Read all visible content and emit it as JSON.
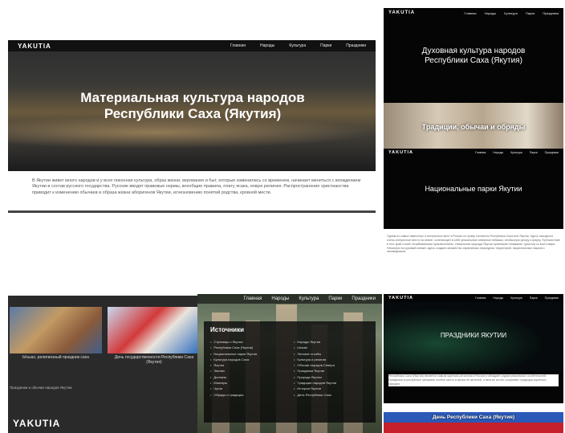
{
  "brand": "YAKUTIA",
  "nav": [
    "Главная",
    "Народы",
    "Культура",
    "Парки",
    "Праздники"
  ],
  "hero": {
    "title": "Материальная культура народов Республики Саха (Якутия)",
    "text": "В Якутии живет много народов и у всех покон­ная культура, образ жизни, верования и быт, которые изменились со временем, начинает меняться с вхождением Якутии в состав русского государства. Русские вводят правовые нормы, всеобщие правила, плату ясака, новую религию. Распространение христианства приводит к изменению обычаев и образа жизни аборигенов Якутии, исчезновению понятий родства, кровной мести."
  },
  "spiritual": {
    "title": "Духовная культура народов Республики Саха (Якутия)",
    "band_title": "Традиции, обычаи и обряды"
  },
  "parks": {
    "title": "Национальные парки Якутии",
    "text": "Одним из самых известных и интересных мест в России по праву считается Республика Саха или Якутия. Здесь находится очень интересное место на земле, сочетающее в себе уникальные северные пейзажи, необычную флору и фауну. Путешествие в этот край станет незабываемым приключением. Уникальная природа Якутии привлекает внимание туристов со всего мира. Несмотря на суровый климат, здесь создано множество охраняемых природных территорий, национальных парков и заповедников."
  },
  "cards": [
    {
      "caption": "Ысыах, религиозный праздник саха"
    },
    {
      "caption": "День государственности Республики Саха (Якутия)"
    }
  ],
  "cards_note": "Праздники и обычаи народов Якутии",
  "sources": {
    "title": "Источники",
    "col1": [
      "Страницы о Якутии",
      "Республика Саха (Якутия)",
      "Национальные парки Якутии",
      "Культура народов Саха",
      "Якутия",
      "Эвенки",
      "Долганы",
      "Юкагиры",
      "Чукчи",
      "Обряды и традиции"
    ],
    "col2": [
      "Народы Якутии",
      "Ысыах",
      "Ленские столбы",
      "Культура и религия",
      "Обычаи народов Севера",
      "Праздники Якутии",
      "Природа Якутии",
      "Традиции народов Якутии",
      "История Якутии",
      "День Республики Саха"
    ]
  },
  "holidays": {
    "title": "ПРАЗДНИКИ ЯКУТИИ",
    "text": "Республика Саха (Якутия) является самым крупным регионом в России и обладает рядом уникальных особенностей. Праздники в республике занимают особое место в жизни её жителей, и многие из них сохраняют традиции коренных народов.",
    "flag_title": "День Республики Саха (Якутия)"
  }
}
